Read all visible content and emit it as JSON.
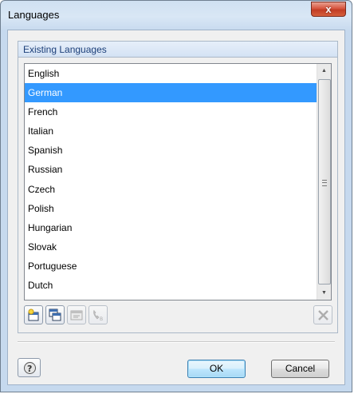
{
  "window": {
    "title": "Languages",
    "close_label": "x"
  },
  "group": {
    "header": "Existing Languages"
  },
  "languages": {
    "items": [
      "English",
      "German",
      "French",
      "Italian",
      "Spanish",
      "Russian",
      "Czech",
      "Polish",
      "Hungarian",
      "Slovak",
      "Portuguese",
      "Dutch"
    ],
    "selected": "German"
  },
  "toolbar": {
    "buttons": [
      {
        "icon": "new-icon",
        "enabled": true
      },
      {
        "icon": "copy-icon",
        "enabled": true
      },
      {
        "icon": "edit-icon",
        "enabled": false
      },
      {
        "icon": "phone-code-icon",
        "enabled": false
      },
      {
        "icon": "delete-icon",
        "enabled": false
      }
    ]
  },
  "footer": {
    "help_icon": "help-icon",
    "ok_label": "OK",
    "cancel_label": "Cancel"
  },
  "colors": {
    "selection": "#3399ff",
    "header_text": "#1c3f79",
    "default_button": "#3c7fb1"
  }
}
